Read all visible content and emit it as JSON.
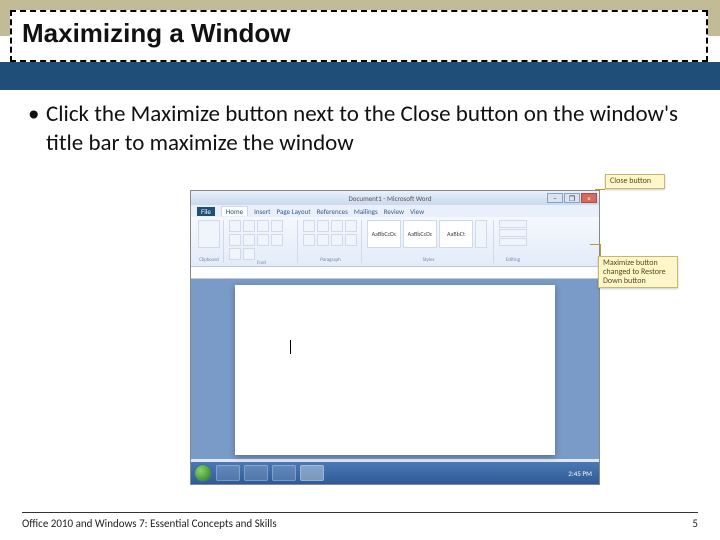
{
  "slide": {
    "title": "Maximizing a Window",
    "bullet1": "Click the Maximize button next to the Close button on the window's title bar to maximize the window"
  },
  "word": {
    "titlebar": "Document1 - Microsoft Word",
    "tabs": {
      "file": "File",
      "home": "Home",
      "insert": "Insert",
      "layout": "Page Layout",
      "refs": "References",
      "mail": "Mailings",
      "review": "Review",
      "view": "View"
    },
    "groups": {
      "clipboard": "Clipboard",
      "font": "Font",
      "paragraph": "Paragraph",
      "styles": "Styles",
      "editing": "Editing"
    },
    "styles": {
      "s1": "AaBbCcDc",
      "s2": "AaBbCcDc",
      "s3": "AaBbCt"
    },
    "taskbar_time": "2:45 PM"
  },
  "callouts": {
    "close": "Close button",
    "restore": "Maximize button changed to Restore Down button"
  },
  "footer": {
    "left": "Office 2010 and Windows 7: Essential Concepts and Skills",
    "page": "5"
  }
}
